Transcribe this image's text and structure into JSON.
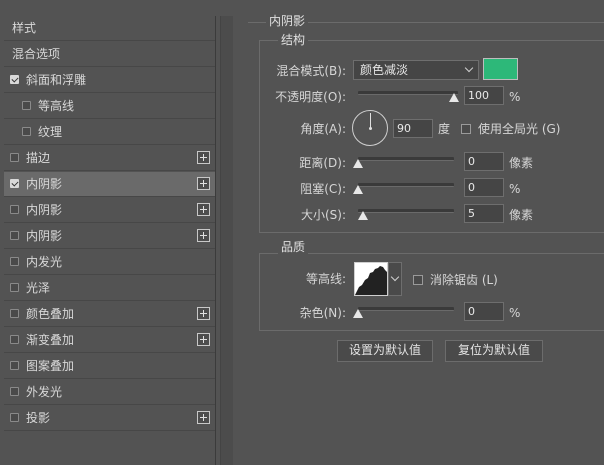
{
  "styles_list": {
    "items": [
      {
        "label": "样式",
        "checkbox": false,
        "checked": false,
        "plus": false,
        "indent": false,
        "selected": false
      },
      {
        "label": "混合选项",
        "checkbox": false,
        "checked": false,
        "plus": false,
        "indent": false,
        "selected": false
      },
      {
        "label": "斜面和浮雕",
        "checkbox": true,
        "checked": true,
        "plus": false,
        "indent": false,
        "selected": false
      },
      {
        "label": "等高线",
        "checkbox": true,
        "checked": false,
        "plus": false,
        "indent": true,
        "selected": false
      },
      {
        "label": "纹理",
        "checkbox": true,
        "checked": false,
        "plus": false,
        "indent": true,
        "selected": false
      },
      {
        "label": "描边",
        "checkbox": true,
        "checked": false,
        "plus": true,
        "indent": false,
        "selected": false
      },
      {
        "label": "内阴影",
        "checkbox": true,
        "checked": true,
        "plus": true,
        "indent": false,
        "selected": true
      },
      {
        "label": "内阴影",
        "checkbox": true,
        "checked": false,
        "plus": true,
        "indent": false,
        "selected": false
      },
      {
        "label": "内阴影",
        "checkbox": true,
        "checked": false,
        "plus": true,
        "indent": false,
        "selected": false
      },
      {
        "label": "内发光",
        "checkbox": true,
        "checked": false,
        "plus": false,
        "indent": false,
        "selected": false
      },
      {
        "label": "光泽",
        "checkbox": true,
        "checked": false,
        "plus": false,
        "indent": false,
        "selected": false
      },
      {
        "label": "颜色叠加",
        "checkbox": true,
        "checked": false,
        "plus": true,
        "indent": false,
        "selected": false
      },
      {
        "label": "渐变叠加",
        "checkbox": true,
        "checked": false,
        "plus": true,
        "indent": false,
        "selected": false
      },
      {
        "label": "图案叠加",
        "checkbox": true,
        "checked": false,
        "plus": false,
        "indent": false,
        "selected": false
      },
      {
        "label": "外发光",
        "checkbox": true,
        "checked": false,
        "plus": false,
        "indent": false,
        "selected": false
      },
      {
        "label": "投影",
        "checkbox": true,
        "checked": false,
        "plus": true,
        "indent": false,
        "selected": false
      }
    ]
  },
  "panel": {
    "title": "内阴影",
    "structure": {
      "title": "结构",
      "blend_mode_label": "混合模式(B):",
      "blend_mode_value": "颜色减淡",
      "color": "#2db879",
      "opacity_label": "不透明度(O):",
      "opacity_value": "100",
      "opacity_percent": 100,
      "opacity_unit": "%",
      "angle_label": "角度(A):",
      "angle_value": "90",
      "angle_unit": "度",
      "global_light_label": "使用全局光 (G)",
      "global_light_checked": false,
      "distance_label": "距离(D):",
      "distance_value": "0",
      "distance_unit": "像素",
      "choke_label": "阻塞(C):",
      "choke_value": "0",
      "choke_unit": "%",
      "size_label": "大小(S):",
      "size_value": "5",
      "size_unit": "像素"
    },
    "quality": {
      "title": "品质",
      "contour_label": "等高线:",
      "anti_alias_label": "消除锯齿 (L)",
      "anti_alias_checked": false,
      "noise_label": "杂色(N):",
      "noise_value": "0",
      "noise_unit": "%"
    },
    "buttons": {
      "make_default": "设置为默认值",
      "reset_default": "复位为默认值"
    }
  }
}
